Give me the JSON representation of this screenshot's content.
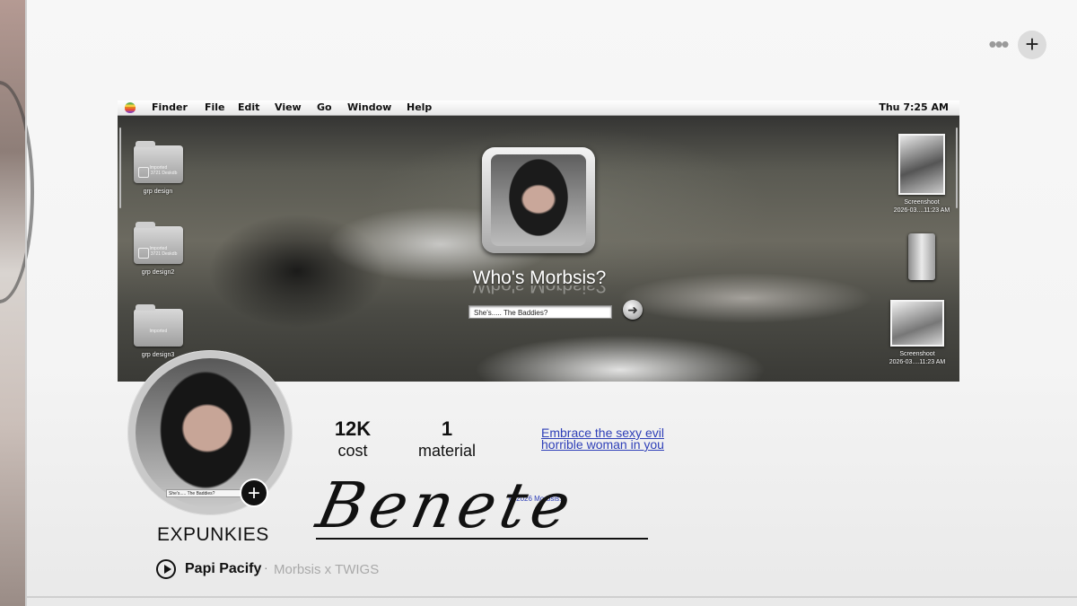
{
  "topbar": {
    "more_icon": "ellipsis-icon",
    "add_icon": "plus-icon"
  },
  "banner": {
    "menubar": {
      "items": [
        "Finder",
        "File",
        "Edit",
        "View",
        "Go",
        "Window",
        "Help"
      ],
      "clock": "Thu 7:25 AM"
    },
    "folders": [
      {
        "label": "grp design",
        "sub": "Imported\n 3721 Deskdb"
      },
      {
        "label": "grp design2",
        "sub": "Imported\n 3721 Deskdb"
      },
      {
        "label": "grp design3",
        "sub": "Imported"
      }
    ],
    "login": {
      "title": "Who's Morbsis?",
      "input_value": "She's..... The Baddies?"
    },
    "desktop_items": [
      {
        "label": "Screenshoot\n2026-03....11:23 AM"
      },
      {
        "label": ""
      },
      {
        "label": "Screenshoot\n2026-03....11:23 AM"
      }
    ]
  },
  "profile": {
    "avatar_caption": "She's..... The Baddies?",
    "username": "EXPUNKIES",
    "stats": [
      {
        "value": "12K",
        "label": "cost"
      },
      {
        "value": "1",
        "label": "material"
      }
    ],
    "tagline": "Embrace the sexy evil horrible woman in you",
    "copyright": "© 2026 Morbsis.",
    "signature": "Benete",
    "now_playing": {
      "song": "Papi Pacify",
      "separator": "·",
      "artist": "Morbsis x TWIGS"
    }
  }
}
